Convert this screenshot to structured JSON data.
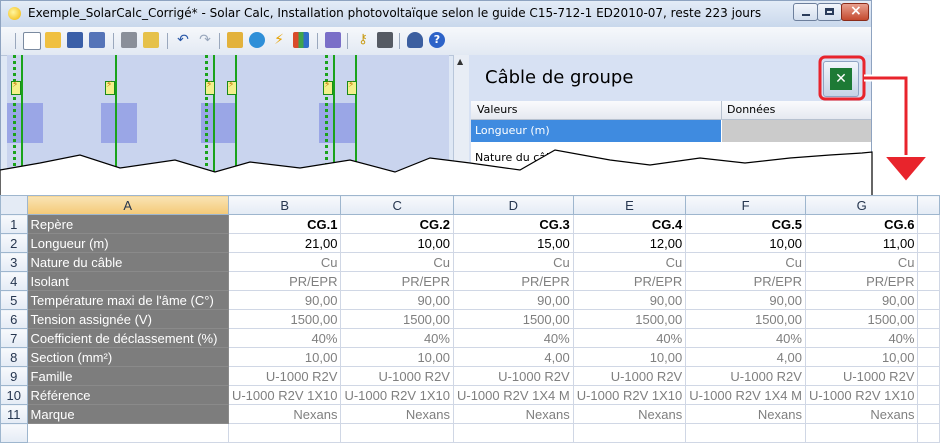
{
  "window": {
    "title": "Exemple_SolarCalc_Corrigé* - Solar Calc, Installation photovoltaïque selon le guide C15-712-1 ED2010-07, reste 223 jours",
    "toolbar_icons": [
      "new-icon",
      "open-icon",
      "save-icon",
      "save-as-icon",
      "print-icon",
      "print-preview-icon",
      "undo-icon",
      "redo-icon",
      "edit-icon",
      "globe-icon",
      "lightning-icon",
      "chart-icon",
      "book-icon",
      "key-icon",
      "settings-icon",
      "user-icon",
      "help-icon"
    ]
  },
  "panel": {
    "title": "Câble de groupe",
    "headers": {
      "values": "Valeurs",
      "data": "Données"
    },
    "rows": [
      "Longueur (m)",
      "Nature du câble"
    ],
    "excel_button_icon": "excel-icon"
  },
  "sheet": {
    "columns": [
      "A",
      "B",
      "C",
      "D",
      "E",
      "F",
      "G"
    ],
    "rows": [
      {
        "n": "1",
        "label": "Repère",
        "values": [
          "CG.1",
          "CG.2",
          "CG.3",
          "CG.4",
          "CG.5",
          "CG.6"
        ]
      },
      {
        "n": "2",
        "label": "Longueur (m)",
        "values": [
          "21,00",
          "10,00",
          "15,00",
          "12,00",
          "10,00",
          "11,00"
        ]
      },
      {
        "n": "3",
        "label": "Nature du câble",
        "values": [
          "Cu",
          "Cu",
          "Cu",
          "Cu",
          "Cu",
          "Cu"
        ]
      },
      {
        "n": "4",
        "label": "Isolant",
        "values": [
          "PR/EPR",
          "PR/EPR",
          "PR/EPR",
          "PR/EPR",
          "PR/EPR",
          "PR/EPR"
        ]
      },
      {
        "n": "5",
        "label": "Température maxi de l'âme (C°)",
        "values": [
          "90,00",
          "90,00",
          "90,00",
          "90,00",
          "90,00",
          "90,00"
        ]
      },
      {
        "n": "6",
        "label": "Tension assignée (V)",
        "values": [
          "1500,00",
          "1500,00",
          "1500,00",
          "1500,00",
          "1500,00",
          "1500,00"
        ]
      },
      {
        "n": "7",
        "label": "Coefficient de déclassement (%)",
        "values": [
          "40%",
          "40%",
          "40%",
          "40%",
          "40%",
          "40%"
        ]
      },
      {
        "n": "8",
        "label": "Section (mm²)",
        "values": [
          "10,00",
          "10,00",
          "4,00",
          "10,00",
          "4,00",
          "10,00"
        ]
      },
      {
        "n": "9",
        "label": "Famille",
        "values": [
          "U-1000 R2V",
          "U-1000 R2V",
          "U-1000 R2V",
          "U-1000 R2V",
          "U-1000 R2V",
          "U-1000 R2V"
        ]
      },
      {
        "n": "10",
        "label": "Référence",
        "values": [
          "U-1000 R2V 1X10",
          "U-1000 R2V 1X10",
          "U-1000 R2V 1X4 M",
          "U-1000 R2V 1X10",
          "U-1000 R2V 1X4 M",
          "U-1000 R2V 1X10"
        ]
      },
      {
        "n": "11",
        "label": "Marque",
        "values": [
          "Nexans",
          "Nexans",
          "Nexans",
          "Nexans",
          "Nexans",
          "Nexans"
        ]
      }
    ]
  }
}
